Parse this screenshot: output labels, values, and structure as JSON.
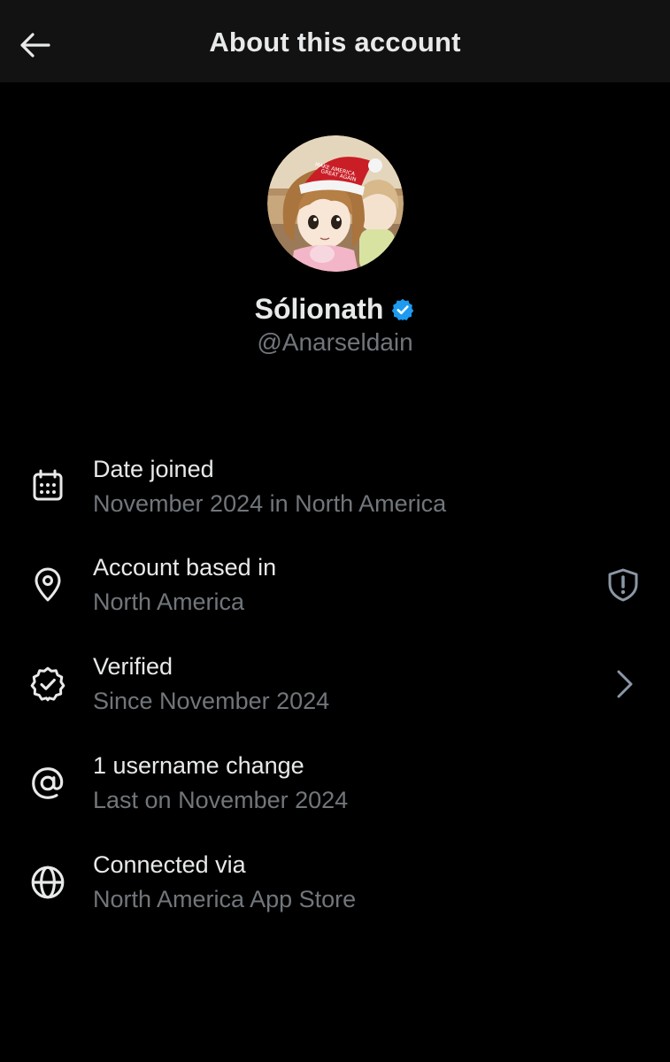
{
  "header": {
    "title": "About this account",
    "back_icon": "arrow-left-icon"
  },
  "profile": {
    "display_name": "Sólionath",
    "handle": "@Anarseldain",
    "verified_badge_icon": "verified-badge-icon",
    "verified_badge_color": "#1d9bf0",
    "avatar_hat_text": "MAKE AMERICA GREAT AGAIN"
  },
  "details": [
    {
      "icon": "calendar-icon",
      "label": "Date joined",
      "value": "November 2024 in North America"
    },
    {
      "icon": "location-pin-icon",
      "label": "Account based in",
      "value": "North America",
      "trailing_icon": "shield-alert-icon"
    },
    {
      "icon": "verified-seal-icon",
      "label": "Verified",
      "value": "Since November 2024",
      "trailing_icon": "chevron-right-icon"
    },
    {
      "icon": "at-sign-icon",
      "label": "1 username change",
      "value": "Last on November 2024"
    },
    {
      "icon": "globe-icon",
      "label": "Connected via",
      "value": "North America App Store"
    }
  ],
  "colors": {
    "background": "#000000",
    "header_background": "#121212",
    "primary_text": "#e7e9ea",
    "secondary_text": "#71767b",
    "accent": "#1d9bf0"
  }
}
